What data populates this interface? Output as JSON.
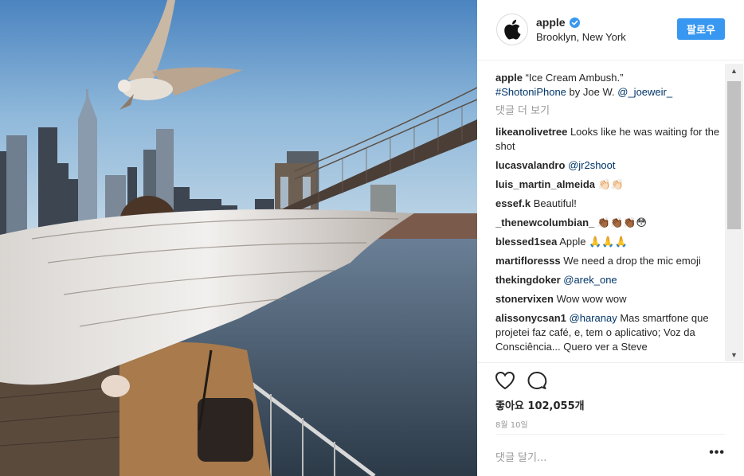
{
  "post": {
    "username": "apple",
    "location": "Brooklyn, New York",
    "follow_label": "팔로우",
    "verified_icon": "verified-badge-icon",
    "accent": "#3897f0"
  },
  "caption": {
    "username": "apple",
    "text": "“Ice Cream Ambush.”",
    "hashtag": "#ShotoniPhone",
    "by": "by Joe W.",
    "mention": "@_joeweir_"
  },
  "more_comments": "댓글 더 보기",
  "comments": [
    {
      "user": "likeanolivetree",
      "text": "Looks like he was waiting for the shot",
      "mention": ""
    },
    {
      "user": "lucasvalandro",
      "text": "",
      "mention": "@jr2shoot"
    },
    {
      "user": "luis_martin_almeida",
      "text": "👏🏻👏🏻",
      "mention": ""
    },
    {
      "user": "essef.k",
      "text": "Beautiful!",
      "mention": ""
    },
    {
      "user": "_thenewcolumbian_",
      "text": "👏🏾👏🏾👏🏾😳",
      "mention": ""
    },
    {
      "user": "blessed1sea",
      "text": "Apple 🙏🙏🙏",
      "mention": ""
    },
    {
      "user": "martifloresss",
      "text": "We need a drop the mic emoji",
      "mention": ""
    },
    {
      "user": "thekingdoker",
      "text": "",
      "mention": "@arek_one"
    },
    {
      "user": "stonervixen",
      "text": "Wow wow wow",
      "mention": ""
    },
    {
      "user": "alissonycsan1",
      "text": "Mas smartfone que projetei faz café, e, tem o aplicativo; Voz da Consciência... Quero ver a Steve",
      "mention": "@haranay"
    }
  ],
  "likes_text": "좋아요 102,055개",
  "date_text": "8월 10일",
  "add_comment_placeholder": "댓글 달기...",
  "more_options": "•••"
}
